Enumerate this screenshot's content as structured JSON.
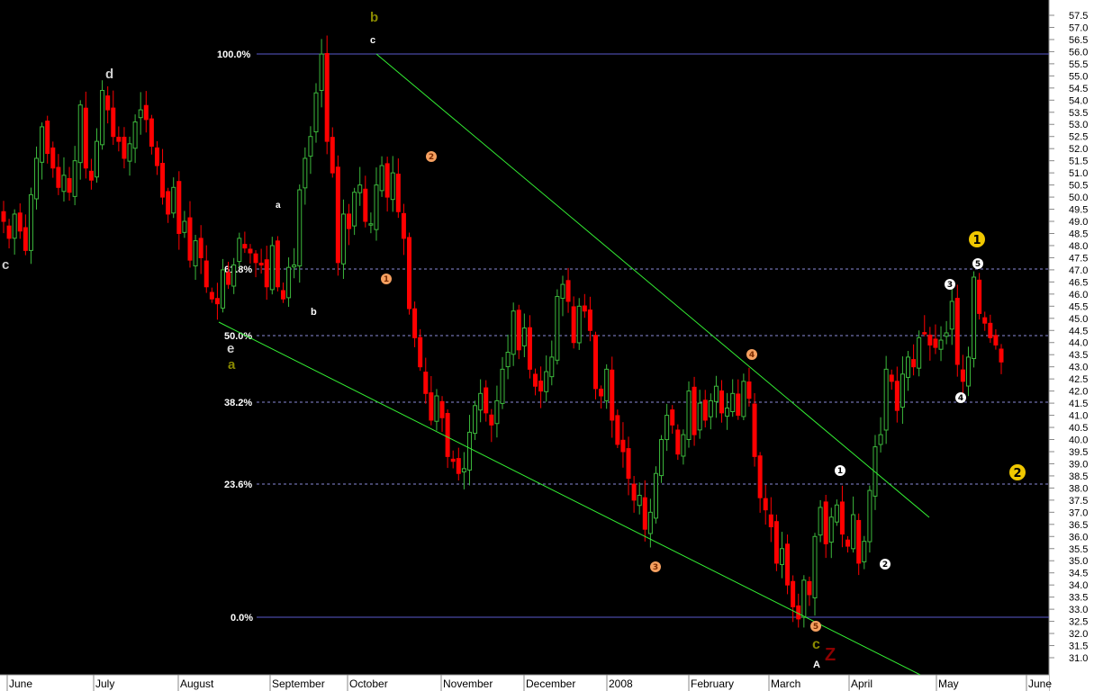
{
  "chart_data": {
    "type": "candlestick",
    "y_axis": {
      "range": [
        30.5,
        57.9
      ],
      "ticks": [
        "57.5",
        "57.0",
        "56.5",
        "56.0",
        "55.5",
        "55.0",
        "54.5",
        "54.0",
        "53.5",
        "53.0",
        "52.5",
        "52.0",
        "51.5",
        "51.0",
        "50.5",
        "50.0",
        "49.5",
        "49.0",
        "48.5",
        "48.0",
        "47.5",
        "47.0",
        "46.5",
        "46.0",
        "45.5",
        "45.0",
        "44.5",
        "44.0",
        "43.5",
        "43.0",
        "42.5",
        "42.0",
        "41.5",
        "41.0",
        "40.5",
        "40.0",
        "39.5",
        "39.0",
        "38.5",
        "38.0",
        "37.5",
        "37.0",
        "36.5",
        "36.0",
        "35.5",
        "35.0",
        "34.5",
        "34.0",
        "33.5",
        "33.0",
        "32.5",
        "32.0",
        "31.5",
        "31.0"
      ]
    },
    "x_axis": {
      "labels": [
        "June",
        "July",
        "August",
        "September",
        "October",
        "November",
        "December",
        "2008",
        "February",
        "March",
        "April",
        "May",
        "June"
      ]
    },
    "fib_levels": [
      {
        "label": "100.0%",
        "value": 55.9
      },
      {
        "label": "61.8%",
        "value": 47.05
      },
      {
        "label": "50.0%",
        "value": 44.3
      },
      {
        "label": "38.2%",
        "value": 41.55
      },
      {
        "label": "23.6%",
        "value": 38.15
      },
      {
        "label": "0.0%",
        "value": 32.55
      }
    ],
    "closes": [
      49.0,
      48.3,
      49.3,
      48.6,
      47.8,
      50.1,
      51.6,
      52.9,
      51.8,
      51.2,
      50.4,
      50.9,
      50.2,
      51.5,
      53.8,
      51.2,
      50.7,
      52.3,
      54.4,
      53.6,
      52.5,
      52.3,
      51.6,
      52.2,
      53.1,
      53.6,
      53.2,
      52.1,
      51.3,
      50.0,
      49.3,
      50.4,
      48.5,
      49.0,
      47.4,
      48.2,
      47.5,
      46.3,
      45.8,
      45.6,
      47.0,
      46.4,
      47.2,
      48.3,
      47.9,
      47.7,
      47.3,
      47.2,
      46.3,
      48.0,
      46.3,
      45.8,
      47.1,
      47.2,
      50.3,
      51.6,
      52.5,
      54.3,
      55.9,
      52.3,
      51.0,
      47.3,
      49.3,
      48.7,
      50.2,
      50.5,
      49.0,
      48.9,
      50.5,
      51.3,
      50.0,
      51.0,
      49.4,
      48.3,
      45.4,
      44.2,
      43.0,
      41.9,
      40.8,
      41.8,
      40.9,
      39.3,
      39.1,
      38.6,
      38.8,
      40.3,
      41.4,
      41.9,
      41.1,
      40.6,
      41.6,
      42.9,
      43.6,
      45.3,
      43.7,
      44.6,
      42.9,
      42.2,
      42.0,
      42.8,
      43.4,
      45.9,
      46.4,
      45.7,
      44.0,
      45.5,
      45.3,
      44.5,
      42.1,
      41.8,
      42.9,
      40.8,
      39.8,
      39.5,
      38.4,
      37.5,
      37.7,
      36.3,
      37.0,
      38.6,
      40.0,
      41.0,
      40.6,
      39.4,
      40.2,
      42.0,
      40.2,
      41.5,
      40.8,
      41.6,
      42.2,
      41.1,
      41.3,
      41.9,
      41.0,
      42.4,
      41.7,
      39.3,
      37.6,
      37.1,
      36.4,
      34.9,
      35.5,
      34.0,
      33.1,
      32.6,
      34.2,
      33.6,
      36.0,
      37.2,
      35.7,
      36.8,
      37.3,
      36.1,
      35.6,
      36.9,
      34.9,
      35.8,
      37.9,
      39.7,
      40.2,
      42.9,
      42.4,
      41.2,
      42.7,
      43.4,
      43.0,
      44.2,
      44.4,
      43.9,
      43.8,
      44.1,
      44.4,
      45.7,
      43.1,
      42.4,
      43.4,
      46.7,
      45.2,
      44.8,
      44.2,
      43.9,
      43.2
    ]
  },
  "axis_text": {
    "y_ticks": [
      "57.5",
      "57.0",
      "56.5",
      "56.0",
      "55.5",
      "55.0",
      "54.5",
      "54.0",
      "53.5",
      "53.0",
      "52.5",
      "52.0",
      "51.5",
      "51.0",
      "50.5",
      "50.0",
      "49.5",
      "49.0",
      "48.5",
      "48.0",
      "47.5",
      "47.0",
      "46.5",
      "46.0",
      "45.5",
      "45.0",
      "44.5",
      "44.0",
      "43.5",
      "43.0",
      "42.5",
      "42.0",
      "41.5",
      "41.0",
      "40.5",
      "40.0",
      "39.5",
      "39.0",
      "38.5",
      "38.0",
      "37.5",
      "37.0",
      "36.5",
      "36.0",
      "35.5",
      "35.0",
      "34.5",
      "34.0",
      "33.5",
      "33.0",
      "32.5",
      "32.0",
      "31.5",
      "31.0"
    ],
    "months": [
      "June",
      "July",
      "August",
      "September",
      "October",
      "November",
      "December",
      "2008",
      "February",
      "March",
      "April",
      "May",
      "June"
    ]
  },
  "annotations": {
    "wave_labels": [
      "c",
      "d",
      "b",
      "c",
      "a",
      "b",
      "e",
      "a",
      "c",
      "Z",
      "A"
    ],
    "wave_colors": [
      "#cfcfcf",
      "#cfcfcf",
      "#8a8a00",
      "#ffffff",
      "#ffffff",
      "#ffffff",
      "#cfcfcf",
      "#8a8a00",
      "#8a8a00",
      "#8b0000",
      "#ffffff"
    ],
    "orange_markers": [
      "1",
      "2",
      "3",
      "4",
      "5"
    ],
    "white_markers": [
      "1",
      "2",
      "3",
      "4",
      "5"
    ],
    "yellow_markers": [
      "1",
      "2"
    ]
  },
  "colors": {
    "background": "#000000",
    "up": "#3cb83c",
    "down": "#ff0000",
    "trendline": "#33ee33",
    "fib_solid": "#5a5acc",
    "fib_dashed": "#8a8ad8",
    "axis_panel": "#ffffff",
    "orange": "#f5a060",
    "yellow": "#f0c800"
  }
}
